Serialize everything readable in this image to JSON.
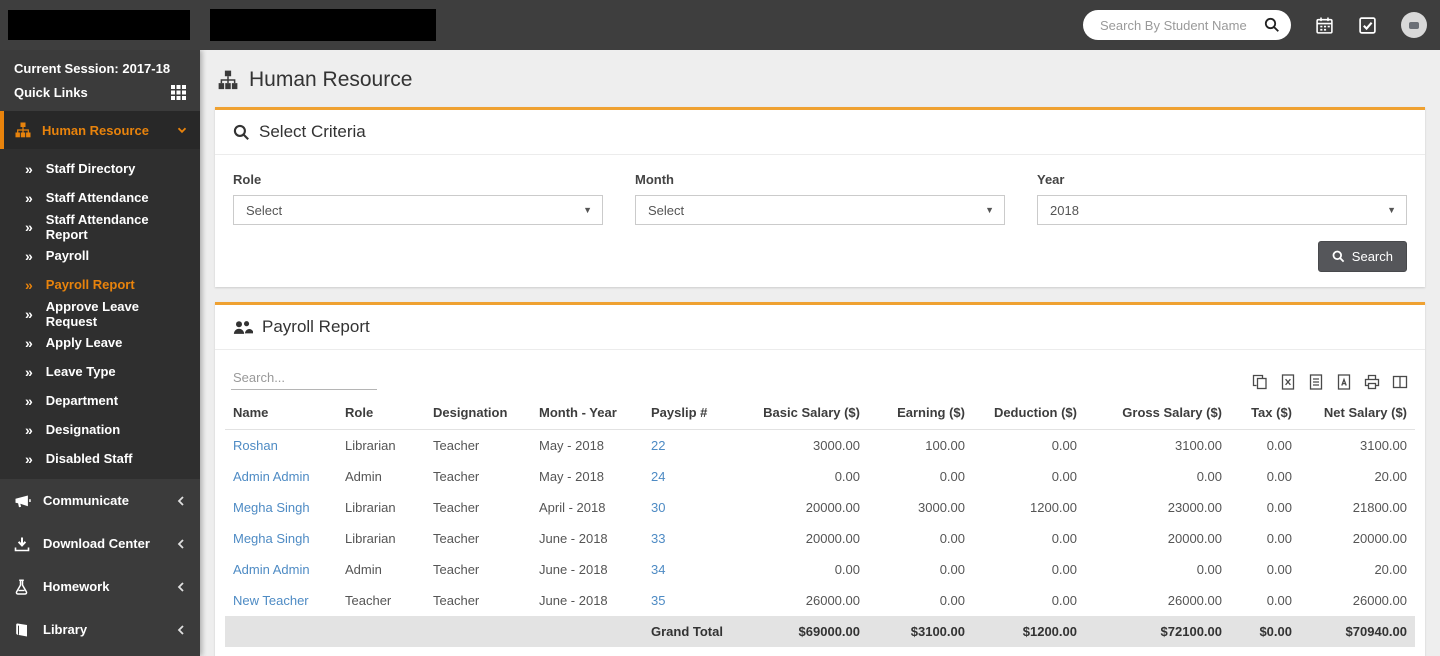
{
  "navbar": {
    "search_placeholder": "Search By Student Name"
  },
  "sidebar": {
    "session": "Current Session: 2017-18",
    "quick_links": "Quick Links",
    "human_resource": "Human Resource",
    "submenu": [
      "Staff Directory",
      "Staff Attendance",
      "Staff Attendance Report",
      "Payroll",
      "Payroll Report",
      "Approve Leave Request",
      "Apply Leave",
      "Leave Type",
      "Department",
      "Designation",
      "Disabled Staff"
    ],
    "active_submenu_item": "Payroll Report",
    "sections": [
      "Communicate",
      "Download Center",
      "Homework",
      "Library"
    ]
  },
  "page": {
    "title": "Human Resource"
  },
  "criteria": {
    "title": "Select Criteria",
    "role_label": "Role",
    "role_value": "Select",
    "month_label": "Month",
    "month_value": "Select",
    "year_label": "Year",
    "year_value": "2018",
    "search_button": "Search"
  },
  "report": {
    "title": "Payroll Report",
    "search_placeholder": "Search...",
    "export_icons": [
      "copy-icon",
      "excel-icon",
      "csv-icon",
      "pdf-icon",
      "print-icon",
      "columns-icon"
    ],
    "columns": [
      "Name",
      "Role",
      "Designation",
      "Month - Year",
      "Payslip #",
      "Basic Salary ($)",
      "Earning ($)",
      "Deduction ($)",
      "Gross Salary ($)",
      "Tax ($)",
      "Net Salary ($)"
    ],
    "rows": [
      {
        "name": "Roshan",
        "role": "Librarian",
        "designation": "Teacher",
        "month_year": "May - 2018",
        "payslip": "22",
        "basic": "3000.00",
        "earning": "100.00",
        "deduction": "0.00",
        "gross": "3100.00",
        "tax": "0.00",
        "net": "3100.00"
      },
      {
        "name": "Admin Admin",
        "role": "Admin",
        "designation": "Teacher",
        "month_year": "May - 2018",
        "payslip": "24",
        "basic": "0.00",
        "earning": "0.00",
        "deduction": "0.00",
        "gross": "0.00",
        "tax": "0.00",
        "net": "20.00"
      },
      {
        "name": "Megha Singh",
        "role": "Librarian",
        "designation": "Teacher",
        "month_year": "April - 2018",
        "payslip": "30",
        "basic": "20000.00",
        "earning": "3000.00",
        "deduction": "1200.00",
        "gross": "23000.00",
        "tax": "0.00",
        "net": "21800.00"
      },
      {
        "name": "Megha Singh",
        "role": "Librarian",
        "designation": "Teacher",
        "month_year": "June - 2018",
        "payslip": "33",
        "basic": "20000.00",
        "earning": "0.00",
        "deduction": "0.00",
        "gross": "20000.00",
        "tax": "0.00",
        "net": "20000.00"
      },
      {
        "name": "Admin Admin",
        "role": "Admin",
        "designation": "Teacher",
        "month_year": "June - 2018",
        "payslip": "34",
        "basic": "0.00",
        "earning": "0.00",
        "deduction": "0.00",
        "gross": "0.00",
        "tax": "0.00",
        "net": "20.00"
      },
      {
        "name": "New Teacher",
        "role": "Teacher",
        "designation": "Teacher",
        "month_year": "June - 2018",
        "payslip": "35",
        "basic": "26000.00",
        "earning": "0.00",
        "deduction": "0.00",
        "gross": "26000.00",
        "tax": "0.00",
        "net": "26000.00"
      }
    ],
    "grand_total": {
      "label": "Grand Total",
      "basic": "$69000.00",
      "earning": "$3100.00",
      "deduction": "$1200.00",
      "gross": "$72100.00",
      "tax": "$0.00",
      "net": "$70940.00"
    }
  },
  "colors": {
    "accent_orange": "#efa131",
    "sidebar_active_orange": "#e8830c",
    "link_blue": "#4e8bc4",
    "navbar_bg": "#3e3e3e",
    "sidebar_bg": "#3b3b3b",
    "submenu_bg": "#2f2f2f",
    "grand_total_bg": "#e3e3e3"
  }
}
